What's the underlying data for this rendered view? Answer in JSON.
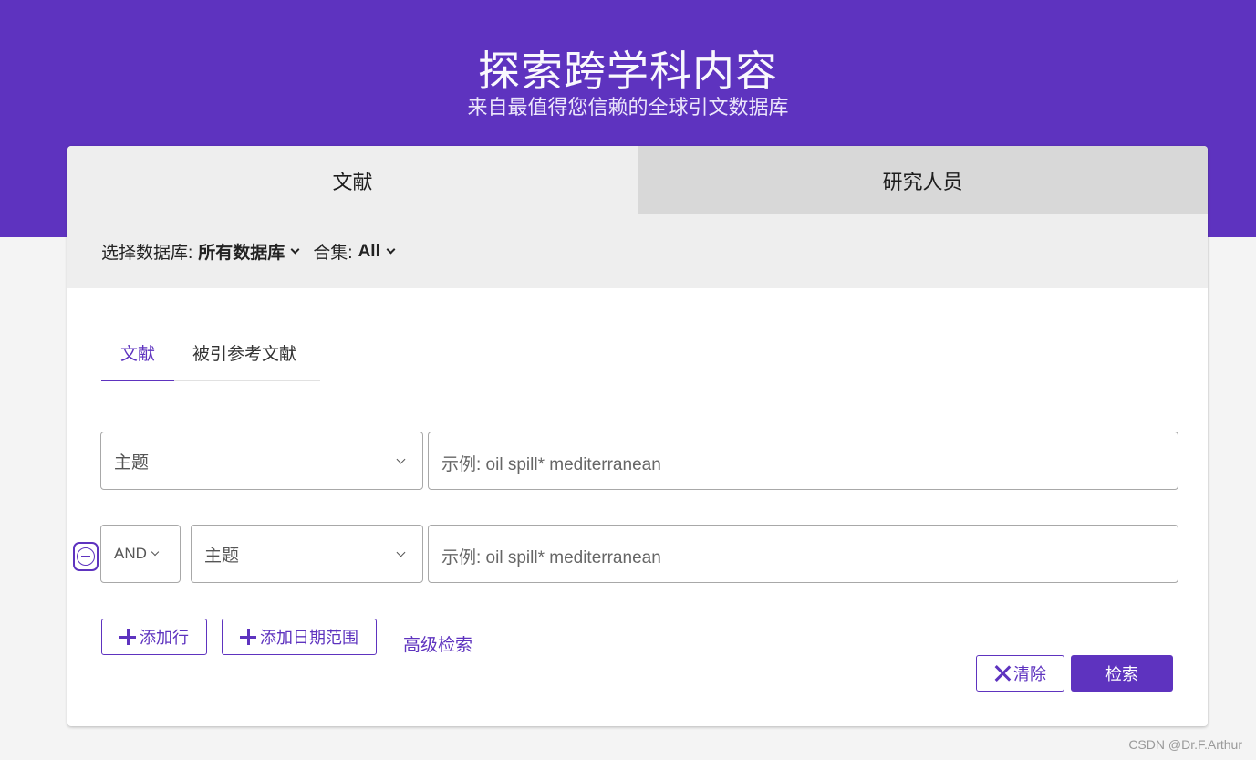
{
  "hero": {
    "title": "探索跨学科内容",
    "subtitle": "来自最值得您信赖的全球引文数据库"
  },
  "main_tabs": [
    {
      "label": "文献",
      "active": true
    },
    {
      "label": "研究人员",
      "active": false
    }
  ],
  "database_bar": {
    "db_label": "选择数据库:",
    "db_value": "所有数据库",
    "collection_label": "合集:",
    "collection_value": "All"
  },
  "sub_tabs": [
    {
      "label": "文献",
      "active": true
    },
    {
      "label": "被引参考文献",
      "active": false
    }
  ],
  "query_rows": [
    {
      "field": "主题",
      "placeholder": "示例: oil spill* mediterranean"
    },
    {
      "operator": "AND",
      "field": "主题",
      "placeholder": "示例: oil spill* mediterranean"
    }
  ],
  "actions": {
    "add_row": "添加行",
    "add_date_range": "添加日期范围",
    "advanced_search": "高级检索",
    "clear": "清除",
    "search": "检索"
  },
  "watermark": "CSDN @Dr.F.Arthur",
  "colors": {
    "accent": "#5e33bf",
    "tab_active_bg": "#eeeeee",
    "tab_inactive_bg": "#d8d8d8",
    "page_bg": "#f4f4f4"
  }
}
